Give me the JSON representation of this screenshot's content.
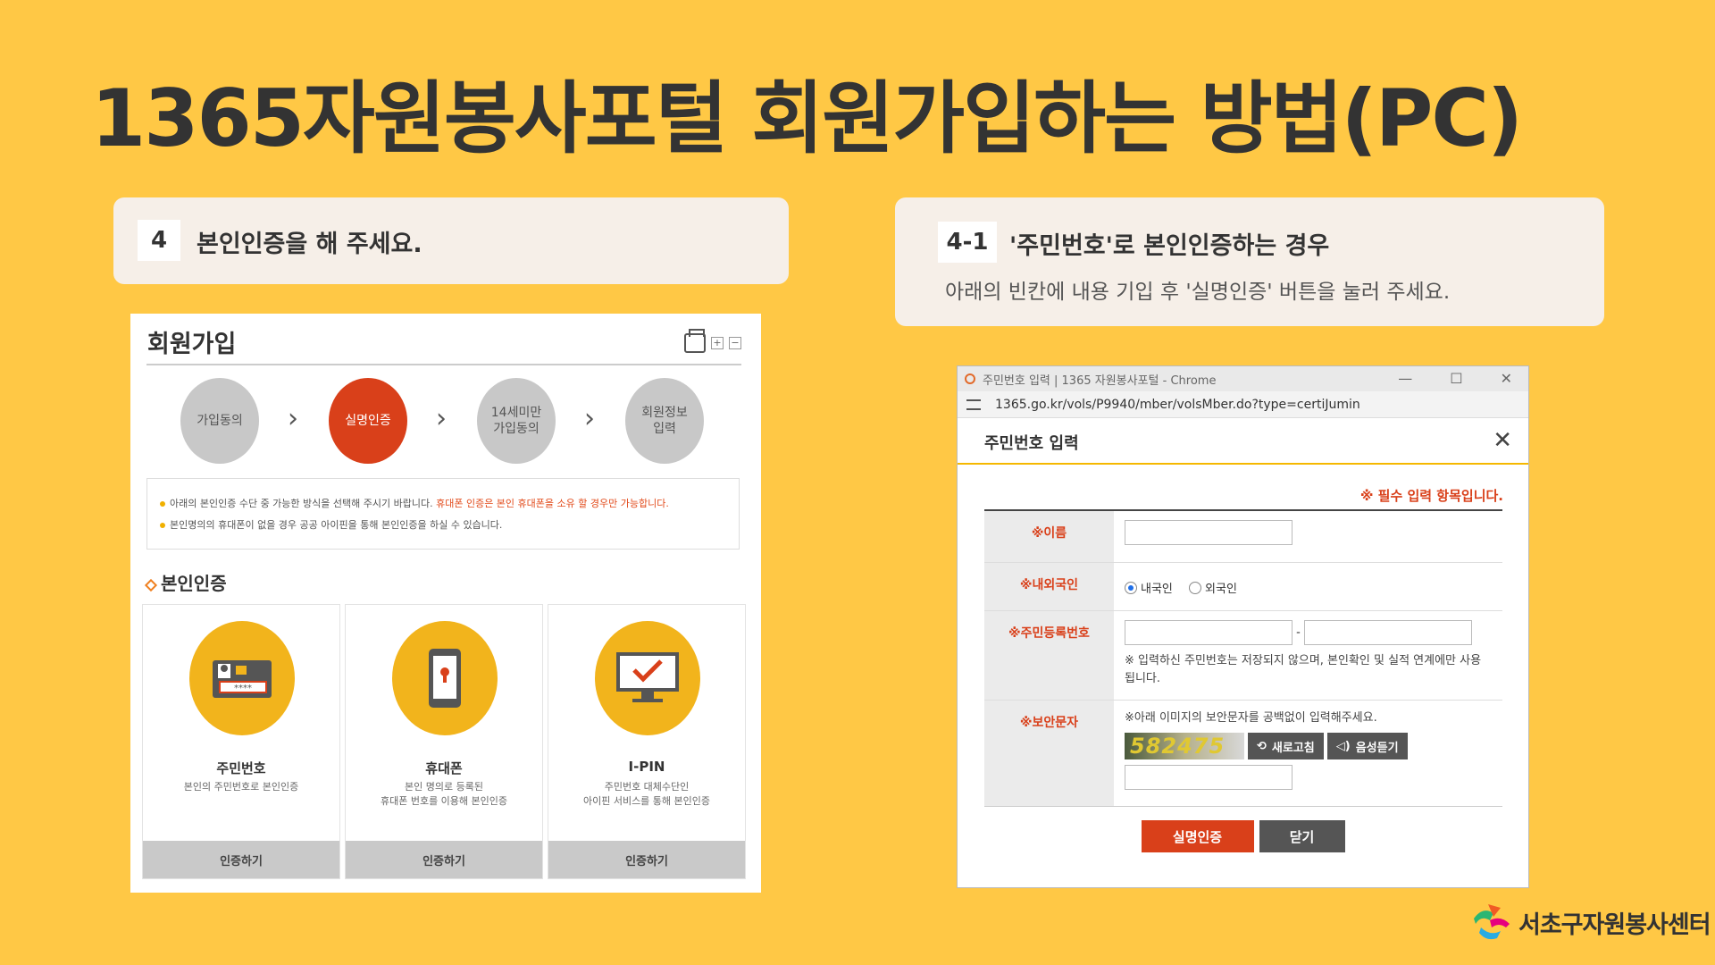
{
  "title": "1365자원봉사포털 회원가입하는 방법(PC)",
  "left_card": {
    "num": "4",
    "title": "본인인증을 해 주세요."
  },
  "right_card": {
    "num": "4-1",
    "title": "'주민번호'로 본인인증하는 경우",
    "sub": "아래의 빈칸에 내용 기입 후 '실명인증' 버튼을 눌러 주세요."
  },
  "left_shot": {
    "title": "회원가입",
    "steps": [
      "가입동의",
      "실명인증",
      "14세미만\n가입동의",
      "회원정보\n입력"
    ],
    "notice1_a": "아래의 본인인증 수단 중 가능한 방식을 선택해 주시기 바랍니다. ",
    "notice1_b": "휴대폰 인증은 본인 휴대폰을 소유 할 경우만 가능합니다.",
    "notice2": "본인명의의 휴대폰이 없을 경우 공공 아이핀을 통해 본인인증을 하실 수 있습니다.",
    "section": "본인인증",
    "methods": [
      {
        "name": "주민번호",
        "desc": "본인의 주민번호로 본인인증",
        "btn": "인증하기"
      },
      {
        "name": "휴대폰",
        "desc": "본인 명의로 등록된\n휴대폰 번호를 이용해 본인인증",
        "btn": "인증하기"
      },
      {
        "name": "I-PIN",
        "desc": "주민번호 대체수단인\n아이핀 서비스를 통해 본인인증",
        "btn": "인증하기"
      }
    ]
  },
  "right_shot": {
    "window_title": "주민번호 입력 | 1365 자원봉사포털 - Chrome",
    "url": "1365.go.kr/vols/P9940/mber/volsMber.do?type=certiJumin",
    "popup_title": "주민번호 입력",
    "required_note": "※ 필수 입력 항목입니다.",
    "labels": {
      "name": "※이름",
      "nationality": "※내외국인",
      "rrn": "※주민등록번호",
      "captcha": "※보안문자"
    },
    "radio_domestic": "내국인",
    "radio_foreign": "외국인",
    "rrn_sep": "-",
    "rrn_note": "※ 입력하신 주민번호는 저장되지 않으며, 본인확인 및 실적 연계에만 사용됩니다.",
    "captcha_note": "※아래 이미지의 보안문자를 공백없이 입력해주세요.",
    "captcha_text": "582475",
    "refresh_btn": "새로고침",
    "audio_btn": "음성듣기",
    "submit_btn": "실명인증",
    "close_btn": "닫기"
  },
  "logo_text": "서초구자원봉사센터"
}
